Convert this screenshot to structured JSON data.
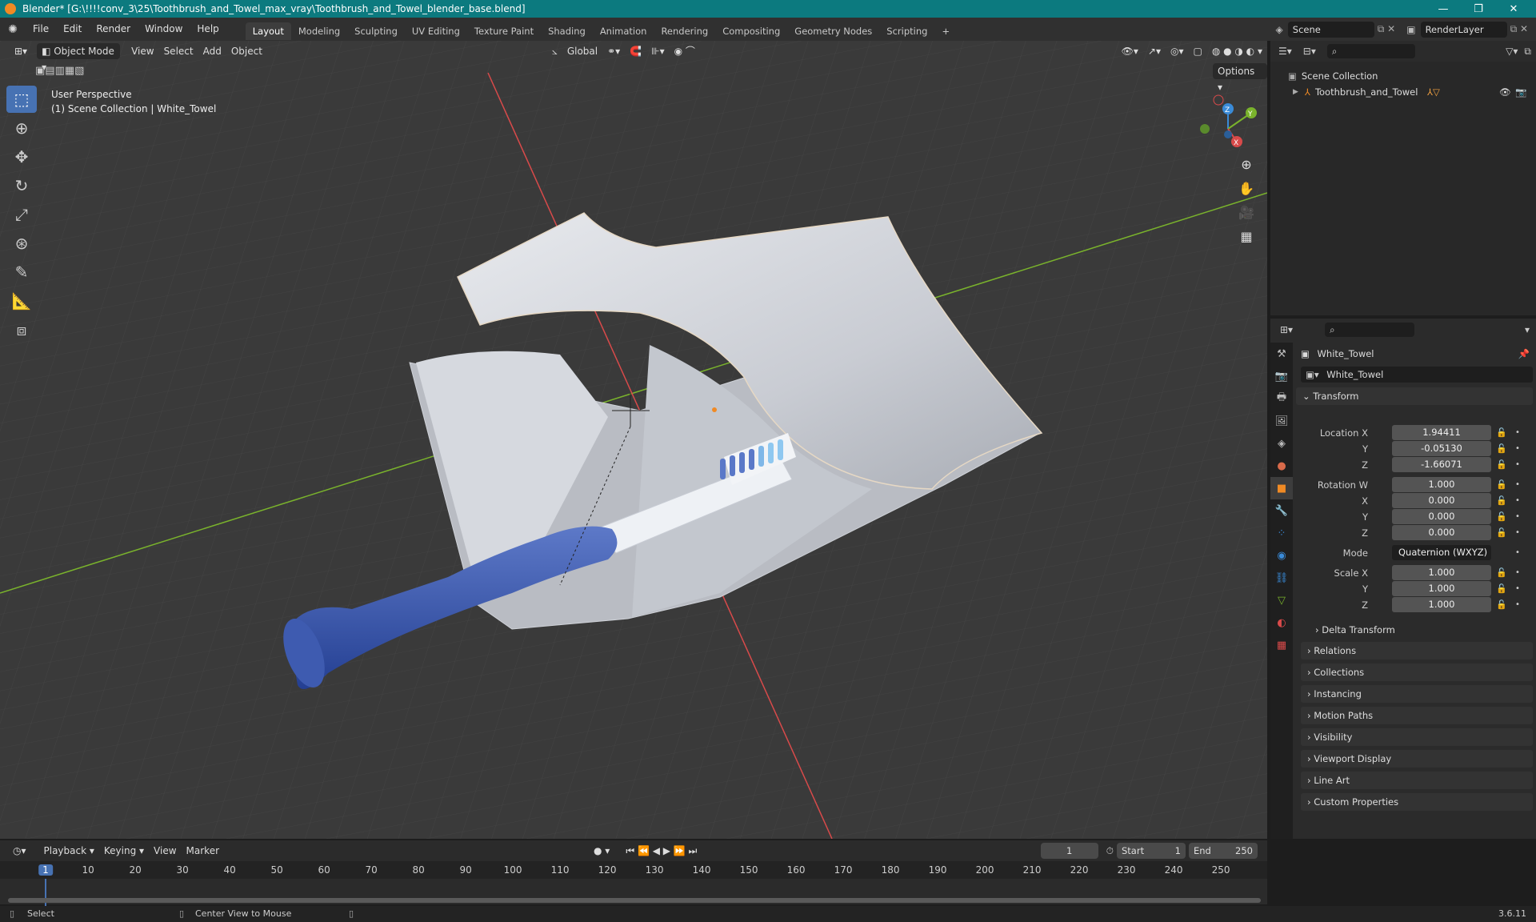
{
  "window": {
    "title": "Blender* [G:\\!!!!conv_3\\25\\Toothbrush_and_Towel_max_vray\\Toothbrush_and_Towel_blender_base.blend]",
    "controls": [
      "—",
      "❐",
      "✕"
    ]
  },
  "menu": [
    "File",
    "Edit",
    "Render",
    "Window",
    "Help"
  ],
  "workspaces": [
    "Layout",
    "Modeling",
    "Sculpting",
    "UV Editing",
    "Texture Paint",
    "Shading",
    "Animation",
    "Rendering",
    "Compositing",
    "Geometry Nodes",
    "Scripting"
  ],
  "workspace_add": "+",
  "scene": {
    "name": "Scene",
    "render_layer": "RenderLayer"
  },
  "viewport": {
    "mode": "Object Mode",
    "menus": [
      "View",
      "Select",
      "Add",
      "Object"
    ],
    "orientation": "Global",
    "options": "Options",
    "perspective": "User Perspective",
    "context": "(1) Scene Collection | White_Towel",
    "gizmo": {
      "z": "Z",
      "y": "Y",
      "x": "X"
    }
  },
  "outliner": {
    "root": "Scene Collection",
    "items": [
      "Toothbrush_and_Towel"
    ]
  },
  "properties": {
    "object_name": "White_Towel",
    "data_name": "White_Towel",
    "transform_label": "Transform",
    "location": {
      "label": "Location X",
      "x": "1.94411",
      "y": "-0.05130",
      "z": "-1.66071"
    },
    "rotation": {
      "label": "Rotation W",
      "w": "1.000",
      "x": "0.000",
      "y": "0.000",
      "z": "0.000"
    },
    "mode": {
      "label": "Mode",
      "value": "Quaternion (WXYZ)"
    },
    "scale": {
      "label": "Scale X",
      "x": "1.000",
      "y": "1.000",
      "z": "1.000"
    },
    "axis": {
      "y": "Y",
      "z": "Z",
      "x": "X"
    },
    "delta": "Delta Transform",
    "sections": [
      "Relations",
      "Collections",
      "Instancing",
      "Motion Paths",
      "Visibility",
      "Viewport Display",
      "Line Art",
      "Custom Properties"
    ]
  },
  "timeline": {
    "menus": [
      "Playback",
      "Keying",
      "View",
      "Marker"
    ],
    "current_frame": "1",
    "start_label": "Start",
    "start": "1",
    "end_label": "End",
    "end": "250",
    "ticks": [
      "1",
      "10",
      "20",
      "30",
      "40",
      "50",
      "60",
      "70",
      "80",
      "90",
      "100",
      "110",
      "120",
      "130",
      "140",
      "150",
      "160",
      "170",
      "180",
      "190",
      "200",
      "210",
      "220",
      "230",
      "240",
      "250"
    ]
  },
  "status": {
    "left": "Select",
    "middle": "Center View to Mouse",
    "version": "3.6.11"
  },
  "colors": {
    "accent": "#4772b3",
    "titlebar": "#0c7a7f",
    "x_axis": "#d84a4a",
    "y_axis": "#7ab32c"
  }
}
